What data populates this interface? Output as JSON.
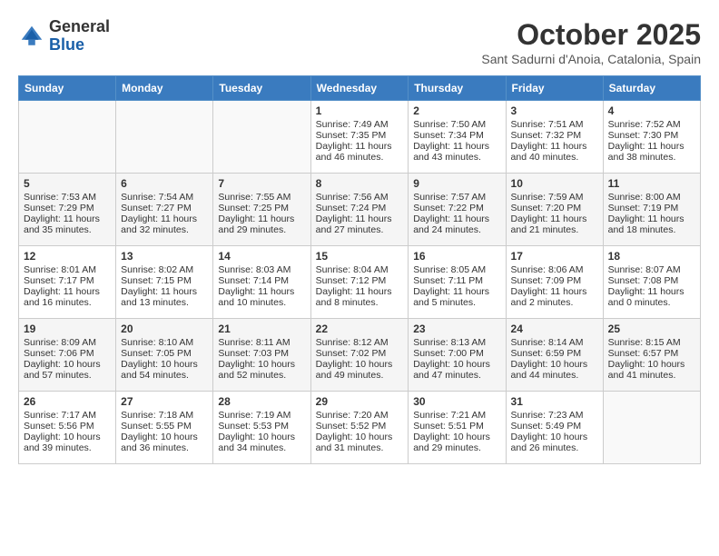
{
  "header": {
    "logo_general": "General",
    "logo_blue": "Blue",
    "month_title": "October 2025",
    "subtitle": "Sant Sadurni d'Anoia, Catalonia, Spain"
  },
  "days_of_week": [
    "Sunday",
    "Monday",
    "Tuesday",
    "Wednesday",
    "Thursday",
    "Friday",
    "Saturday"
  ],
  "weeks": [
    [
      {
        "day": "",
        "content": ""
      },
      {
        "day": "",
        "content": ""
      },
      {
        "day": "",
        "content": ""
      },
      {
        "day": "1",
        "content": "Sunrise: 7:49 AM\nSunset: 7:35 PM\nDaylight: 11 hours and 46 minutes."
      },
      {
        "day": "2",
        "content": "Sunrise: 7:50 AM\nSunset: 7:34 PM\nDaylight: 11 hours and 43 minutes."
      },
      {
        "day": "3",
        "content": "Sunrise: 7:51 AM\nSunset: 7:32 PM\nDaylight: 11 hours and 40 minutes."
      },
      {
        "day": "4",
        "content": "Sunrise: 7:52 AM\nSunset: 7:30 PM\nDaylight: 11 hours and 38 minutes."
      }
    ],
    [
      {
        "day": "5",
        "content": "Sunrise: 7:53 AM\nSunset: 7:29 PM\nDaylight: 11 hours and 35 minutes."
      },
      {
        "day": "6",
        "content": "Sunrise: 7:54 AM\nSunset: 7:27 PM\nDaylight: 11 hours and 32 minutes."
      },
      {
        "day": "7",
        "content": "Sunrise: 7:55 AM\nSunset: 7:25 PM\nDaylight: 11 hours and 29 minutes."
      },
      {
        "day": "8",
        "content": "Sunrise: 7:56 AM\nSunset: 7:24 PM\nDaylight: 11 hours and 27 minutes."
      },
      {
        "day": "9",
        "content": "Sunrise: 7:57 AM\nSunset: 7:22 PM\nDaylight: 11 hours and 24 minutes."
      },
      {
        "day": "10",
        "content": "Sunrise: 7:59 AM\nSunset: 7:20 PM\nDaylight: 11 hours and 21 minutes."
      },
      {
        "day": "11",
        "content": "Sunrise: 8:00 AM\nSunset: 7:19 PM\nDaylight: 11 hours and 18 minutes."
      }
    ],
    [
      {
        "day": "12",
        "content": "Sunrise: 8:01 AM\nSunset: 7:17 PM\nDaylight: 11 hours and 16 minutes."
      },
      {
        "day": "13",
        "content": "Sunrise: 8:02 AM\nSunset: 7:15 PM\nDaylight: 11 hours and 13 minutes."
      },
      {
        "day": "14",
        "content": "Sunrise: 8:03 AM\nSunset: 7:14 PM\nDaylight: 11 hours and 10 minutes."
      },
      {
        "day": "15",
        "content": "Sunrise: 8:04 AM\nSunset: 7:12 PM\nDaylight: 11 hours and 8 minutes."
      },
      {
        "day": "16",
        "content": "Sunrise: 8:05 AM\nSunset: 7:11 PM\nDaylight: 11 hours and 5 minutes."
      },
      {
        "day": "17",
        "content": "Sunrise: 8:06 AM\nSunset: 7:09 PM\nDaylight: 11 hours and 2 minutes."
      },
      {
        "day": "18",
        "content": "Sunrise: 8:07 AM\nSunset: 7:08 PM\nDaylight: 11 hours and 0 minutes."
      }
    ],
    [
      {
        "day": "19",
        "content": "Sunrise: 8:09 AM\nSunset: 7:06 PM\nDaylight: 10 hours and 57 minutes."
      },
      {
        "day": "20",
        "content": "Sunrise: 8:10 AM\nSunset: 7:05 PM\nDaylight: 10 hours and 54 minutes."
      },
      {
        "day": "21",
        "content": "Sunrise: 8:11 AM\nSunset: 7:03 PM\nDaylight: 10 hours and 52 minutes."
      },
      {
        "day": "22",
        "content": "Sunrise: 8:12 AM\nSunset: 7:02 PM\nDaylight: 10 hours and 49 minutes."
      },
      {
        "day": "23",
        "content": "Sunrise: 8:13 AM\nSunset: 7:00 PM\nDaylight: 10 hours and 47 minutes."
      },
      {
        "day": "24",
        "content": "Sunrise: 8:14 AM\nSunset: 6:59 PM\nDaylight: 10 hours and 44 minutes."
      },
      {
        "day": "25",
        "content": "Sunrise: 8:15 AM\nSunset: 6:57 PM\nDaylight: 10 hours and 41 minutes."
      }
    ],
    [
      {
        "day": "26",
        "content": "Sunrise: 7:17 AM\nSunset: 5:56 PM\nDaylight: 10 hours and 39 minutes."
      },
      {
        "day": "27",
        "content": "Sunrise: 7:18 AM\nSunset: 5:55 PM\nDaylight: 10 hours and 36 minutes."
      },
      {
        "day": "28",
        "content": "Sunrise: 7:19 AM\nSunset: 5:53 PM\nDaylight: 10 hours and 34 minutes."
      },
      {
        "day": "29",
        "content": "Sunrise: 7:20 AM\nSunset: 5:52 PM\nDaylight: 10 hours and 31 minutes."
      },
      {
        "day": "30",
        "content": "Sunrise: 7:21 AM\nSunset: 5:51 PM\nDaylight: 10 hours and 29 minutes."
      },
      {
        "day": "31",
        "content": "Sunrise: 7:23 AM\nSunset: 5:49 PM\nDaylight: 10 hours and 26 minutes."
      },
      {
        "day": "",
        "content": ""
      }
    ]
  ]
}
